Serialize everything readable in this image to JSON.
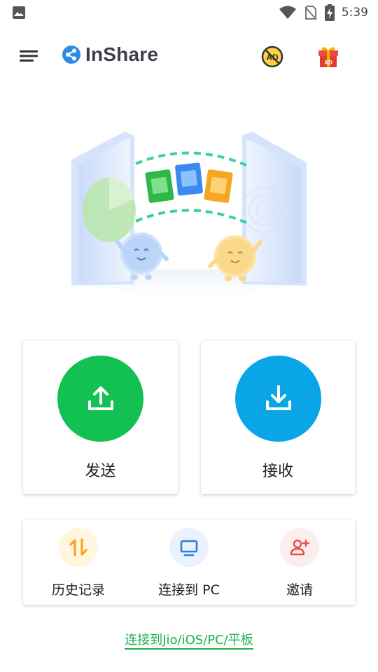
{
  "status_bar": {
    "time": "5:39",
    "icons": [
      "photo-icon",
      "wifi-icon",
      "no-sim-icon",
      "battery-charging-icon"
    ]
  },
  "app_bar": {
    "brand_name": "InShare",
    "icons": [
      "menu-icon",
      "share-logo-icon",
      "no-ads-icon",
      "gift-icon"
    ],
    "no_ads_badge": "AD",
    "gift_badge": "AD"
  },
  "actions": {
    "send_label": "发送",
    "receive_label": "接收",
    "send_color": "#12c152",
    "receive_color": "#0aa5e6"
  },
  "tools": {
    "items": [
      {
        "label": "历史记录",
        "icon": "history-transfer-icon",
        "color": "#f5a623"
      },
      {
        "label": "连接到 PC",
        "icon": "monitor-icon",
        "color": "#2a7fe0"
      },
      {
        "label": "邀请",
        "icon": "invite-user-icon",
        "color": "#e94b4b"
      }
    ]
  },
  "footer": {
    "link_text": "连接到Jio/iOS/PC/平板",
    "link_color": "#1bb24b"
  }
}
